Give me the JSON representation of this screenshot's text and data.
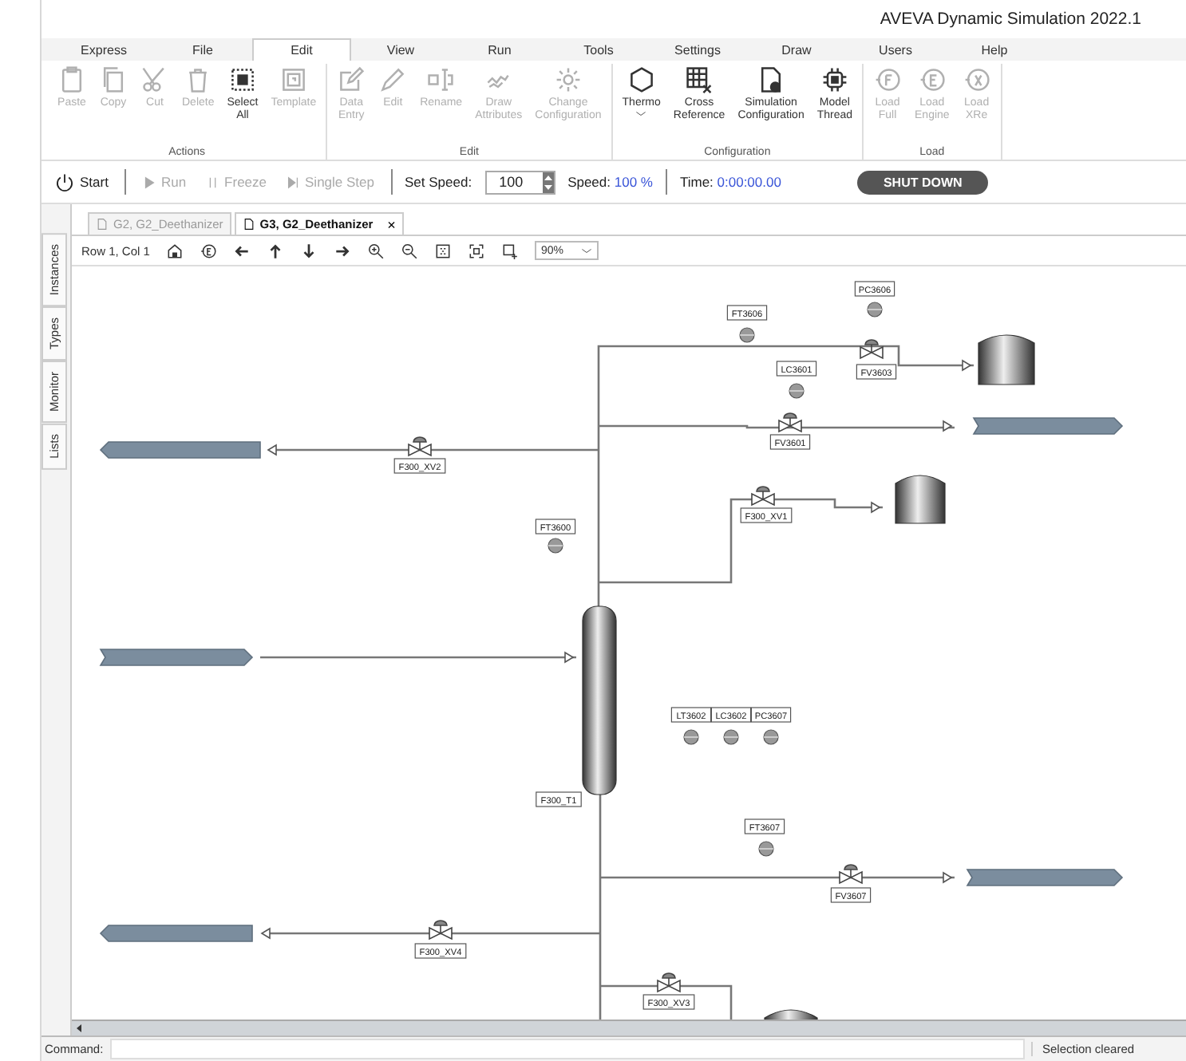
{
  "window": {
    "title": "AVEVA Dynamic Simulation  2022.1"
  },
  "menu_tabs": [
    {
      "label": "Express",
      "selected": false
    },
    {
      "label": "File",
      "selected": false
    },
    {
      "label": "Edit",
      "selected": true
    },
    {
      "label": "View",
      "selected": false
    },
    {
      "label": "Run",
      "selected": false
    },
    {
      "label": "Tools",
      "selected": false
    },
    {
      "label": "Settings",
      "selected": false
    },
    {
      "label": "Draw",
      "selected": false
    },
    {
      "label": "Users",
      "selected": false
    },
    {
      "label": "Help",
      "selected": false
    }
  ],
  "ribbon_groups": [
    {
      "label": "Actions",
      "buttons": [
        {
          "label": "Paste",
          "disabled": true
        },
        {
          "label": "Copy",
          "disabled": true
        },
        {
          "label": "Cut",
          "disabled": true
        },
        {
          "label": "Delete",
          "disabled": true
        },
        {
          "label": "Select All",
          "disabled": false
        },
        {
          "label": "Template",
          "disabled": true
        }
      ]
    },
    {
      "label": "Edit",
      "buttons": [
        {
          "label": "Data Entry",
          "disabled": true
        },
        {
          "label": "Edit",
          "disabled": true
        },
        {
          "label": "Rename",
          "disabled": true
        },
        {
          "label": "Draw Attributes",
          "disabled": true
        },
        {
          "label": "Change Configuration",
          "disabled": true
        }
      ]
    },
    {
      "label": "Configuration",
      "buttons": [
        {
          "label": "Thermo",
          "disabled": false,
          "dropdown": true
        },
        {
          "label": "Cross Reference",
          "disabled": false
        },
        {
          "label": "Simulation Configuration",
          "disabled": false
        },
        {
          "label": "Model Thread",
          "disabled": false
        }
      ]
    },
    {
      "label": "Load",
      "buttons": [
        {
          "label": "Load Full",
          "disabled": true
        },
        {
          "label": "Load Engine",
          "disabled": true
        },
        {
          "label": "Load XRe",
          "disabled": true
        }
      ]
    }
  ],
  "sim_toolbar": {
    "buttons": [
      {
        "label": "Start",
        "disabled": false
      },
      {
        "label": "Run",
        "disabled": true
      },
      {
        "label": "Freeze",
        "disabled": true
      },
      {
        "label": "Single Step",
        "disabled": true
      }
    ],
    "speed_label": "Set Speed:",
    "speed_value": "100",
    "actual_speed_label": "Speed:",
    "actual_speed": "100 %",
    "time_label": "Time:",
    "time": "0:00:00.00",
    "shutdown": "SHUT DOWN"
  },
  "doc_tabs": [
    {
      "label": "G2, G2_Deethanizer",
      "selected": false
    },
    {
      "label": "G3, G2_Deethanizer",
      "selected": true,
      "close": "×"
    }
  ],
  "canvas_toolbar": {
    "position": "Row 1, Col 1",
    "zoom": "90%"
  },
  "side_tabs": [
    "Instances",
    "Types",
    "Monitor",
    "Lists"
  ],
  "diagram": {
    "tags": [
      "FT3606",
      "PC3606",
      "LC3601",
      "FV3603",
      "FV3601",
      "F300_XV2",
      "FT3600",
      "F300_XV1",
      "LT3602",
      "LC3602",
      "PC3607",
      "F300_T1",
      "FT3607",
      "FV3607",
      "F300_XV4",
      "F300_XV3"
    ]
  },
  "status_bar": {
    "command_label": "Command:",
    "message": "Selection cleared"
  }
}
